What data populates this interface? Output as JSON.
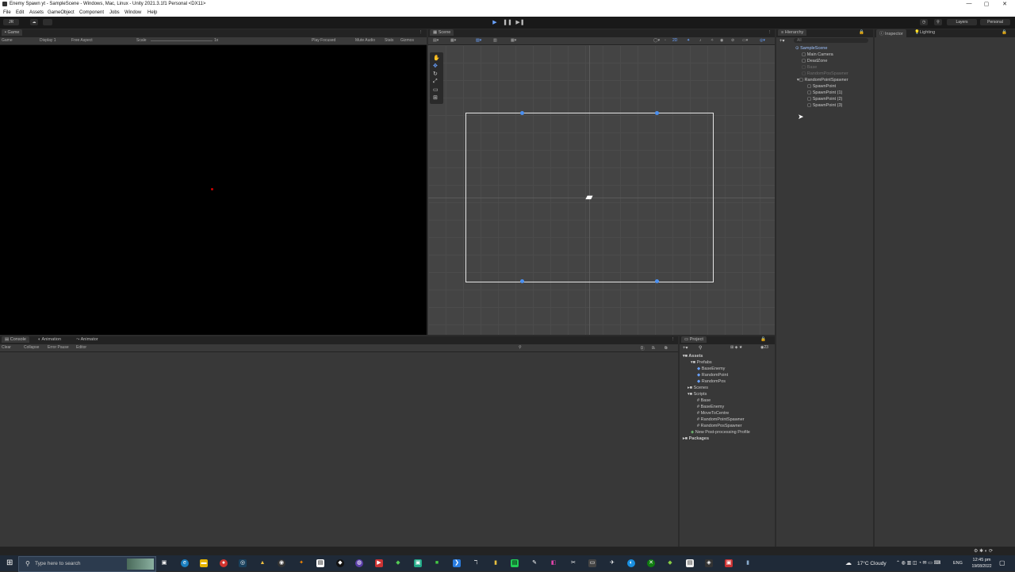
{
  "window": {
    "title": "Enemy Spawn yt - SampleScene - Windows, Mac, Linux - Unity 2021.3.1f1 Personal <DX11>",
    "controls": [
      "—",
      "▢",
      "✕"
    ]
  },
  "menu": [
    "File",
    "Edit",
    "Assets",
    "GameObject",
    "Component",
    "Jobs",
    "Window",
    "Help"
  ],
  "toolbar": {
    "account": "JR",
    "layers_label": "Layers",
    "layout_label": "Personal"
  },
  "game_panel": {
    "tab_label": "Game",
    "display_mode": "Game",
    "display": "Display 1",
    "aspect": "Free Aspect",
    "scale_label": "Scale",
    "scale_value": "1x",
    "play_focused": "Play Focused",
    "mute_audio": "Mute Audio",
    "stats": "Stats",
    "gizmos": "Gizmos"
  },
  "scene_panel": {
    "tab_label": "Scene",
    "mode_2d": "2D"
  },
  "hierarchy": {
    "tab_label": "Hierarchy",
    "search_placeholder": "All",
    "items": [
      {
        "label": "SampleScene",
        "accent": true
      },
      {
        "label": "Main Camera"
      },
      {
        "label": "DeadZone"
      },
      {
        "label": "Base",
        "dim": true
      },
      {
        "label": "RandomPosSpawner",
        "dim": true
      },
      {
        "label": "RandomPointSpawner"
      },
      {
        "label": "SpawnPoint"
      },
      {
        "label": "SpawnPoint (1)"
      },
      {
        "label": "SpawnPoint (2)"
      },
      {
        "label": "SpawnPoint (3)"
      }
    ]
  },
  "inspector": {
    "tab_label": "Inspector",
    "lighting_label": "Lighting"
  },
  "console": {
    "tabs": [
      "Console",
      "Animation",
      "Animator"
    ],
    "clear": "Clear",
    "collapse": "Collapse",
    "error_pause": "Error Pause",
    "editor": "Editor",
    "counts": [
      "0",
      "0",
      "0"
    ]
  },
  "project": {
    "tab_label": "Project",
    "badge": "23",
    "items": [
      {
        "label": "Assets",
        "bold": true
      },
      {
        "label": "Prefabs"
      },
      {
        "label": "BaseEnemy"
      },
      {
        "label": "RandomPoint"
      },
      {
        "label": "RandomPos"
      },
      {
        "label": "Scenes"
      },
      {
        "label": "Scripts"
      },
      {
        "label": "Base"
      },
      {
        "label": "BaseEnemy"
      },
      {
        "label": "MoveToCentre"
      },
      {
        "label": "RandomPointSpawner"
      },
      {
        "label": "RandomPosSpawner"
      },
      {
        "label": "New Post-processing Profile"
      },
      {
        "label": "Packages",
        "bold": true
      }
    ]
  },
  "taskbar": {
    "search_placeholder": "Type here to search",
    "weather": "17°C  Cloudy",
    "language": "ENG",
    "time": "12:45 pm",
    "date": "19/08/2022"
  },
  "colors": {
    "accent": "#4a8ff0",
    "play": "#6aa2ff",
    "scene_bg": "#444444"
  }
}
